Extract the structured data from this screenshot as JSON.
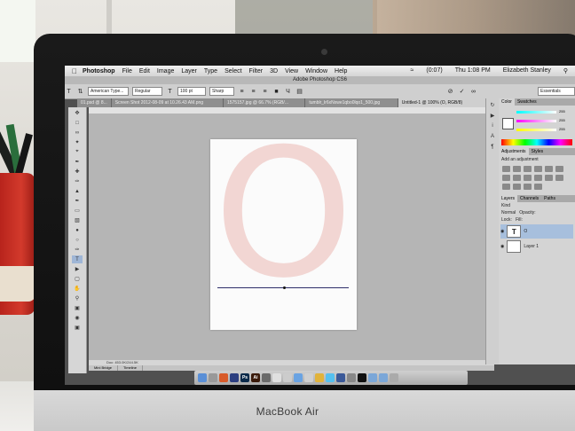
{
  "menubar": {
    "app": "Photoshop",
    "items": [
      "File",
      "Edit",
      "Image",
      "Layer",
      "Type",
      "Select",
      "Filter",
      "3D",
      "View",
      "Window",
      "Help"
    ],
    "battery": "(0:07)",
    "clock": "Thu 1:08 PM",
    "user": "Elizabeth Stanley"
  },
  "window": {
    "title": "Adobe Photoshop CS6"
  },
  "options": {
    "font_family": "American Type...",
    "font_style": "Regular",
    "font_size": "100 pt",
    "antialias": "Sharp",
    "workspace": "Essentials"
  },
  "tabs": [
    "01.psd @ 8...",
    "Screen Shot 2012-08-09 at 10.26.43 AM.png",
    "1575157.jpg @ 66.7% (RGB/...",
    "tumblr_lr6xNxwe1qbo0lqo1_500.jpg",
    "Untitled-1 @ 100% (O, RGB/8)"
  ],
  "canvas": {
    "letter": "O"
  },
  "status": {
    "doc": "Doc: 453.0K/244.5K"
  },
  "bottom_tabs": [
    "Mini Bridge",
    "Timeline"
  ],
  "panels": {
    "color_tabs": [
      "Color",
      "Swatches"
    ],
    "adjust_tabs": [
      "Adjustments",
      "Styles"
    ],
    "add_adjustment": "Add an adjustment",
    "layer_tabs": [
      "Layers",
      "Channels",
      "Paths"
    ],
    "kind": "Kind",
    "blend": "Normal",
    "opacity_label": "Opacity:",
    "lock_label": "Lock:",
    "fill_label": "Fill:",
    "layers": [
      {
        "name": "O",
        "type": "T"
      },
      {
        "name": "Layer 1",
        "type": ""
      }
    ],
    "slider_values": [
      "255",
      "255",
      "255"
    ]
  },
  "brand": "MacBook Air",
  "colors": {
    "canvas_letter": "#f2d6d3",
    "selected_layer": "#a7bfdd"
  }
}
